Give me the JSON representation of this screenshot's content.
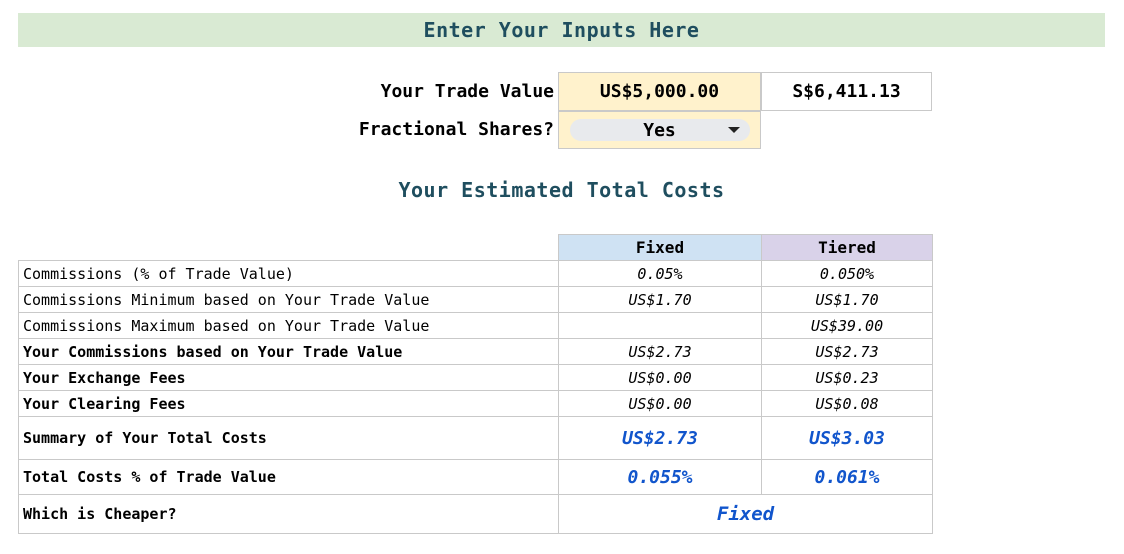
{
  "header": {
    "title": "Enter Your Inputs Here"
  },
  "inputs": {
    "trade_value_label": "Your Trade Value",
    "trade_value_usd": "US$5,000.00",
    "trade_value_sgd": "S$6,411.13",
    "fractional_label": "Fractional Shares?",
    "fractional_value": "Yes"
  },
  "results": {
    "title": "Your Estimated Total Costs",
    "columns": {
      "fixed": "Fixed",
      "tiered": "Tiered"
    },
    "rows": [
      {
        "label": "Commissions (% of Trade Value)",
        "fixed": "0.05%",
        "tiered": "0.050%"
      },
      {
        "label": "Commissions Minimum based on Your Trade Value",
        "fixed": "US$1.70",
        "tiered": "US$1.70"
      },
      {
        "label": "Commissions Maximum based on Your Trade Value",
        "fixed": "",
        "tiered": "US$39.00"
      },
      {
        "label": "Your Commissions based on Your Trade Value",
        "fixed": "US$2.73",
        "tiered": "US$2.73"
      },
      {
        "label": "Your Exchange Fees",
        "fixed": "US$0.00",
        "tiered": "US$0.23"
      },
      {
        "label": "Your Clearing Fees",
        "fixed": "US$0.00",
        "tiered": "US$0.08"
      }
    ],
    "summary": {
      "label": "Summary of Your Total Costs",
      "fixed": "US$2.73",
      "tiered": "US$3.03"
    },
    "percent": {
      "label": "Total Costs % of Trade Value",
      "fixed": "0.055%",
      "tiered": "0.061%"
    },
    "cheaper": {
      "label": "Which is Cheaper?",
      "value": "Fixed"
    }
  },
  "colors": {
    "banner_bg": "#d9ead3",
    "input_bg": "#fff2cc",
    "fixed_header_bg": "#cfe2f3",
    "tiered_header_bg": "#d9d2e9",
    "result_text": "#1155cc",
    "heading_text": "#1f4e5f"
  }
}
